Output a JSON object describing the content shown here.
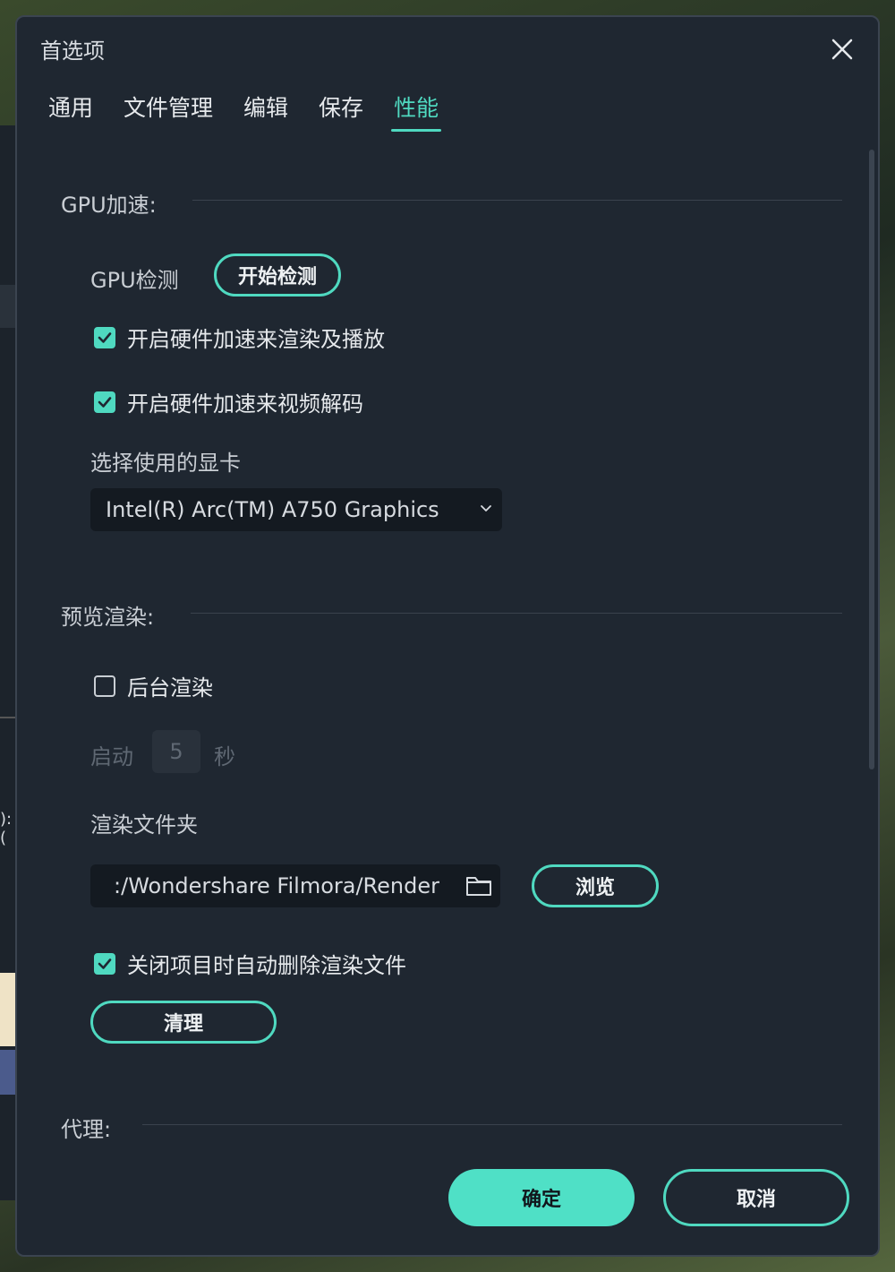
{
  "dialog": {
    "title": "首选项",
    "tabs": [
      {
        "label": "通用"
      },
      {
        "label": "文件管理"
      },
      {
        "label": "编辑"
      },
      {
        "label": "保存"
      },
      {
        "label": "性能",
        "active": true
      }
    ]
  },
  "gpu": {
    "section_title": "GPU加速:",
    "detect_label": "GPU检测",
    "detect_button": "开始检测",
    "hw_render_label": "开启硬件加速来渲染及播放",
    "hw_render_checked": true,
    "hw_decode_label": "开启硬件加速来视频解码",
    "hw_decode_checked": true,
    "card_label": "选择使用的显卡",
    "card_value": "Intel(R) Arc(TM) A750 Graphics"
  },
  "preview": {
    "section_title": "预览渲染:",
    "bg_render_label": "后台渲染",
    "bg_render_checked": false,
    "start_label": "启动",
    "start_value": "5",
    "seconds_label": "秒",
    "folder_label": "渲染文件夹",
    "folder_value": ":/Wondershare Filmora/Render",
    "browse_button": "浏览",
    "auto_delete_label": "关闭项目时自动删除渲染文件",
    "auto_delete_checked": true,
    "clean_button": "清理"
  },
  "proxy": {
    "section_title": "代理:"
  },
  "footer": {
    "ok_button": "确定",
    "cancel_button": "取消"
  },
  "background": {
    "fragment_text": "):("
  },
  "colors": {
    "accent": "#4fd9c0",
    "dialog_bg": "#1f2731",
    "input_bg": "#141a21"
  }
}
